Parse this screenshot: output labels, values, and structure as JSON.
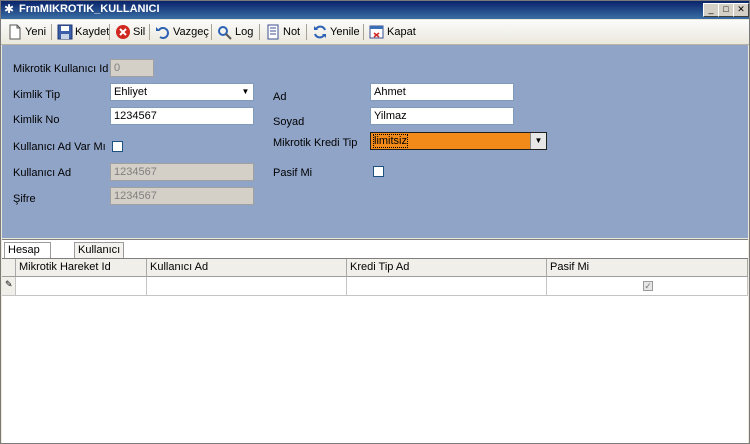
{
  "window": {
    "title": "FrmMIKROTIK_KULLANICI"
  },
  "toolbar": {
    "yeni": "Yeni",
    "kaydet": "Kaydet",
    "sil": "Sil",
    "vazgec": "Vazgeç",
    "log": "Log",
    "not": "Not",
    "yenile": "Yenile",
    "kapat": "Kapat"
  },
  "form": {
    "id_label": "Mikrotik Kullanıcı Id",
    "id_value": "0",
    "kimlik_tip_label": "Kimlik Tip",
    "kimlik_tip_value": "Ehliyet",
    "kimlik_no_label": "Kimlik No",
    "kimlik_no_value": "1234567",
    "kad_var_label": "Kullanıcı Ad Var Mı",
    "kad_label": "Kullanıcı Ad",
    "kad_value": "1234567",
    "sifre_label": "Şifre",
    "sifre_value": "1234567",
    "ad_label": "Ad",
    "ad_value": "Ahmet",
    "soyad_label": "Soyad",
    "soyad_value": "Yilmaz",
    "kredi_label": "Mikrotik Kredi Tip",
    "kredi_value": "limitsiz",
    "pasif_label": "Pasif Mi"
  },
  "tabs": {
    "hesap": "Hesap Hareket",
    "arama": "Kullanıcı Arama"
  },
  "grid": {
    "columns": [
      "Mikrotik Hareket Id",
      "Kullanıcı Ad",
      "Kredi Tip Ad",
      "Pasif Mi"
    ]
  }
}
